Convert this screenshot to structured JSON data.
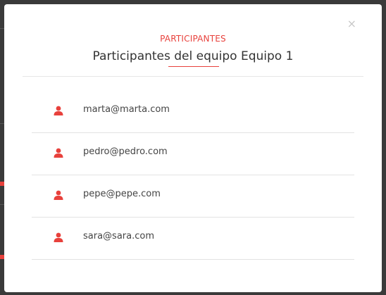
{
  "modal": {
    "eyebrow": "PARTICIPANTES",
    "title": "Participantes del equipo Equipo 1",
    "close_glyph": "×"
  },
  "participants": [
    {
      "email": "marta@marta.com",
      "icon": "user-icon"
    },
    {
      "email": "pedro@pedro.com",
      "icon": "user-icon"
    },
    {
      "email": "pepe@pepe.com",
      "icon": "user-icon"
    },
    {
      "email": "sara@sara.com",
      "icon": "user-icon"
    }
  ],
  "colors": {
    "accent": "#e8413c",
    "overlay": "#3a3a3a"
  }
}
